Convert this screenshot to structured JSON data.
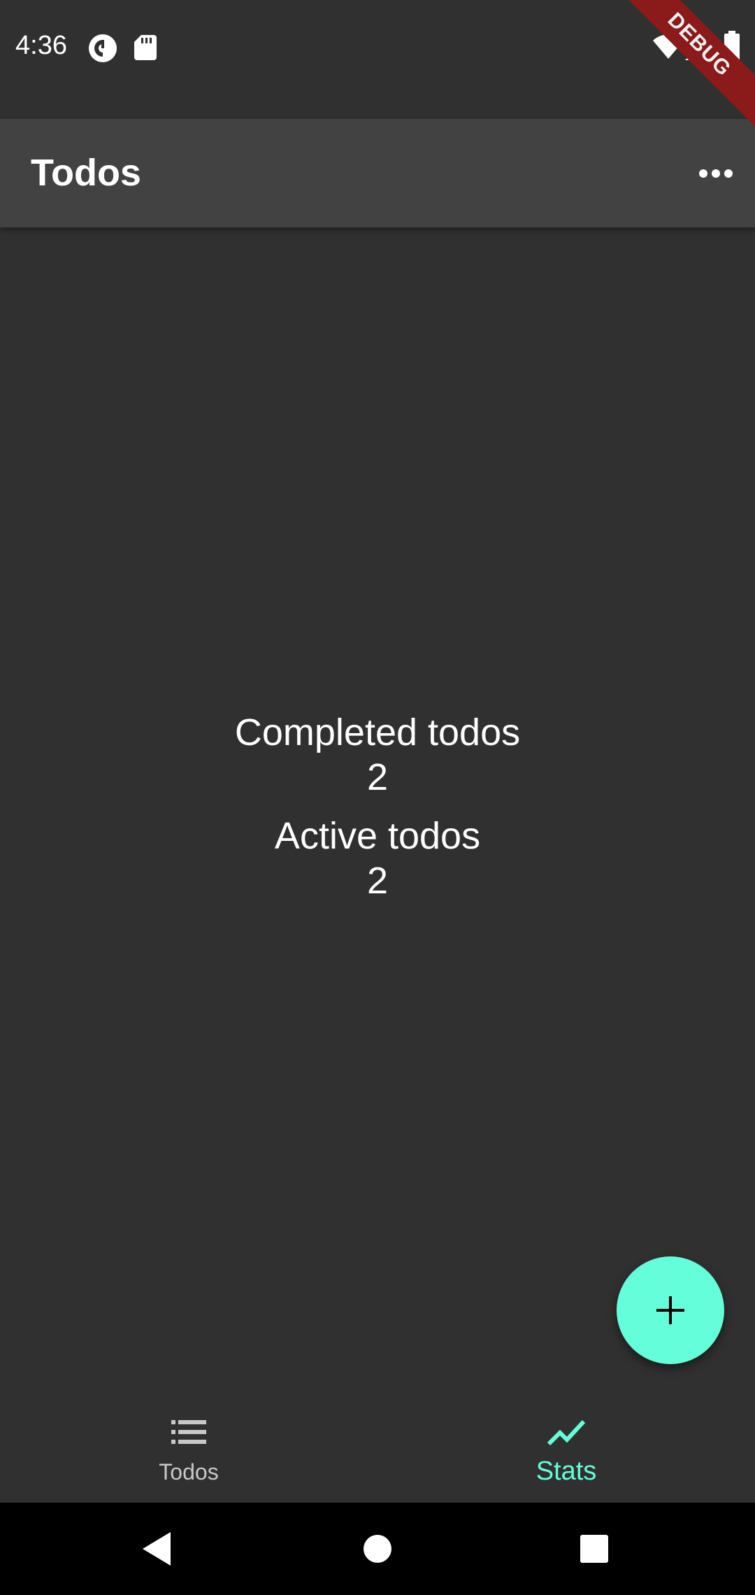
{
  "status_bar": {
    "time": "4:36",
    "icons": [
      "pocket-casts-icon",
      "sd-card-icon",
      "wifi-icon",
      "signal-icon",
      "battery-icon"
    ]
  },
  "debug_banner": "DEBUG",
  "app_bar": {
    "title": "Todos",
    "overflow_icon": "more-horiz-icon"
  },
  "stats": {
    "completed_label": "Completed todos",
    "completed_value": "2",
    "active_label": "Active todos",
    "active_value": "2"
  },
  "fab": {
    "icon": "add-icon"
  },
  "bottom_nav": {
    "items": [
      {
        "label": "Todos",
        "icon": "list-icon",
        "selected": false
      },
      {
        "label": "Stats",
        "icon": "show-chart-icon",
        "selected": true
      }
    ]
  },
  "system_nav": {
    "icons": [
      "back-icon",
      "home-icon",
      "recents-icon"
    ]
  },
  "colors": {
    "background": "#303030",
    "app_bar": "#424242",
    "accent": "#64ffda",
    "debug_banner": "#8b1a1a"
  }
}
